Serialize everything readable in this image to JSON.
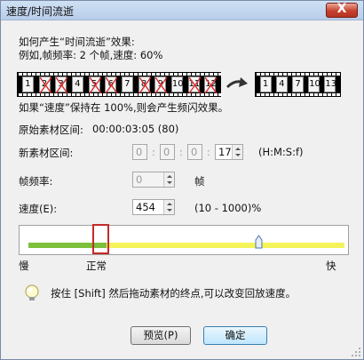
{
  "window": {
    "title": "速度/时间流逝",
    "close_label": "X"
  },
  "description": {
    "line1": "如何产生“时间流逝”效果:",
    "line2": "例如,帧频率: 2 个帧,速度: 60%"
  },
  "filmstrip": {
    "source_frames": [
      "1",
      "2",
      "3",
      "4",
      "5",
      "6",
      "7",
      "8",
      "9",
      "10",
      "11",
      "12"
    ],
    "crossed_frames": [
      "2",
      "3",
      "5",
      "6",
      "8",
      "9",
      "11",
      "12"
    ],
    "result_frames": [
      "1",
      "4",
      "7",
      "10",
      "13"
    ]
  },
  "note": "如果“速度”保持在 100%,则会产生频闪效果。",
  "fields": {
    "original_range_label": "原始素材区间:",
    "original_range_value": "00:00:03:05 (80)",
    "new_range_label": "新素材区间:",
    "new_range_parts": [
      "0",
      "0",
      "0",
      "17"
    ],
    "new_range_format": "(H:M:S:f)",
    "frame_rate_label": "帧频率:",
    "frame_rate_value": "0",
    "frame_rate_unit": "帧",
    "speed_label": "速度(E):",
    "speed_value": "454",
    "speed_range": "(10 - 1000)%"
  },
  "slider": {
    "value_percent": 454,
    "min": 10,
    "max": 1000,
    "slow_label": "慢",
    "normal_label": "正常",
    "fast_label": "快"
  },
  "tip": "按住 [Shift] 然后拖动素材的终点,可以改变回放速度。",
  "buttons": {
    "preview": "预览(P)",
    "ok": "确定"
  },
  "colors": {
    "track_green": "#7cbf3a",
    "track_yellow": "#f4f35a",
    "highlight_red": "#c62a2a"
  }
}
